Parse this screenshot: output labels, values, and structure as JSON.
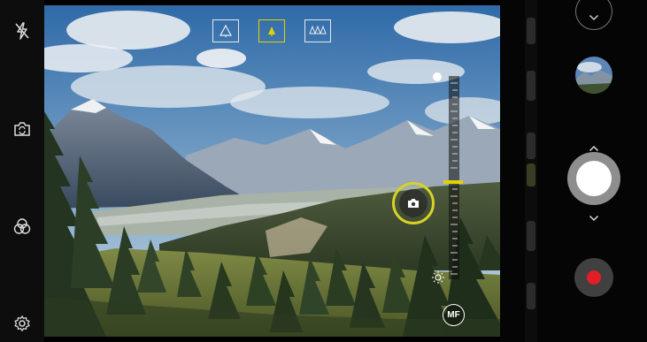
{
  "app": "Camera",
  "left_rail": {
    "icons": [
      "flash-off-icon",
      "switch-camera-icon",
      "filter-icon",
      "settings-icon"
    ]
  },
  "lens_selector": {
    "items": [
      {
        "icon": "wide-angle-icon",
        "selected": false
      },
      {
        "icon": "standard-angle-icon",
        "selected": true
      },
      {
        "icon": "telephoto-icon",
        "selected": false
      }
    ]
  },
  "manual_focus": {
    "button_label": "MF",
    "slider_level": 0.48
  },
  "brightness": {
    "top_icon": "bright-icon",
    "bottom_icon": "dim-icon"
  },
  "focus_indicator": {
    "icon": "camera-icon"
  },
  "right_panel": {
    "collapse_icon": "chevron-down-icon",
    "gallery_icon": "gallery-thumbnail",
    "shutter_icon": "shutter-button",
    "record_icon": "record-button"
  },
  "colors": {
    "accent_yellow": "#e3d200",
    "record_red": "#e21e26",
    "shutter_gray": "#8e8e8e"
  }
}
